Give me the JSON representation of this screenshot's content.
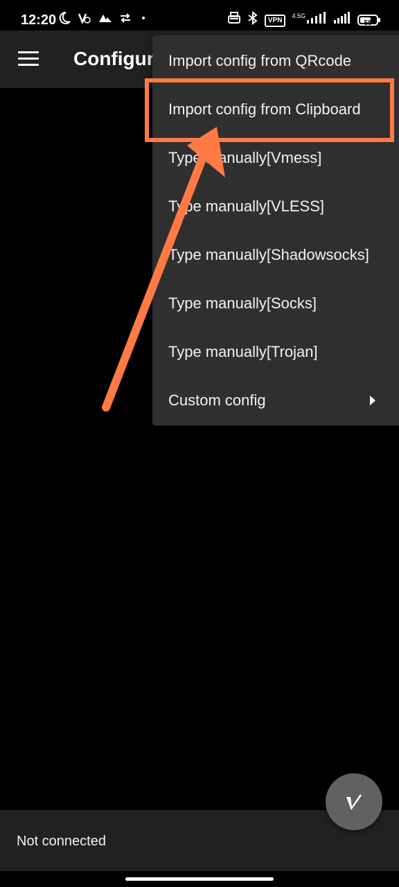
{
  "status_bar": {
    "time": "12:20",
    "vpn": "VPN",
    "network": "4.5G",
    "battery": "58",
    "icons": [
      "moon-icon",
      "vowifi-icon",
      "drive-icon",
      "data-saver-icon",
      "dot-icon",
      "printer-icon",
      "bluetooth-icon",
      "vpn-icon",
      "signal-icon",
      "signal-icon-2",
      "battery-icon"
    ]
  },
  "app_bar": {
    "title": "Configuration",
    "menu_icon": "hamburger-menu-icon"
  },
  "menu": {
    "items": [
      {
        "label": "Import config from QRcode"
      },
      {
        "label": "Import config from Clipboard"
      },
      {
        "label": "Type manually[Vmess]"
      },
      {
        "label": "Type manually[VLESS]"
      },
      {
        "label": "Type manually[Shadowsocks]"
      },
      {
        "label": "Type manually[Socks]"
      },
      {
        "label": "Type manually[Trojan]"
      },
      {
        "label": "Custom config"
      }
    ]
  },
  "annotation": {
    "highlight_color": "#ff7a45"
  },
  "bottom": {
    "connection_status": "Not connected",
    "fab_icon": "v2ray-v-icon"
  }
}
